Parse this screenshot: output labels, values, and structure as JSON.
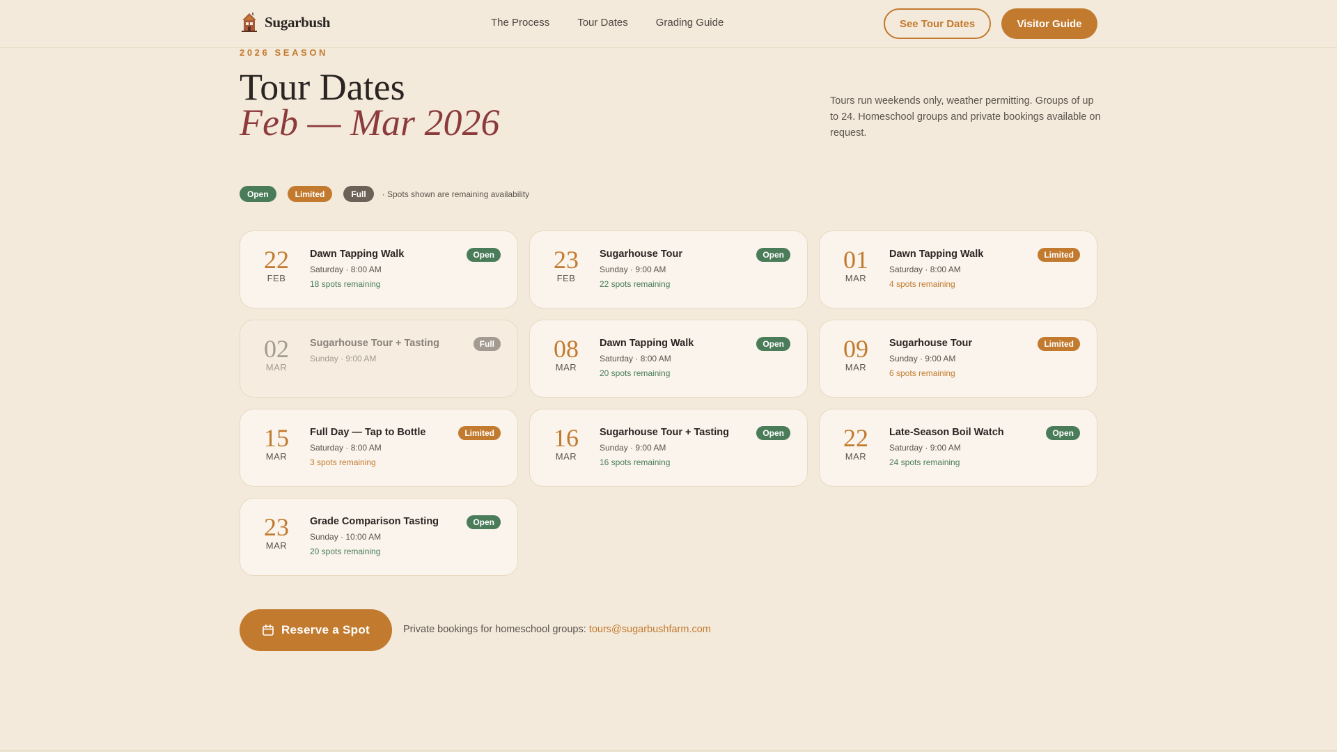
{
  "brand": {
    "name": "Sugarbush",
    "logo_icon": "maple-sugarhouse-icon"
  },
  "nav": {
    "items": [
      "The Process",
      "Tour Dates",
      "Grading Guide"
    ]
  },
  "header_buttons": {
    "outline": "See Tour Dates",
    "solid": "Visitor Guide"
  },
  "hero": {
    "eyebrow": "2026 SEASON",
    "title": "Tour Dates",
    "subtitle": "Feb — Mar 2026",
    "intro": "Tours run weekends only, weather permitting. Groups of up to 24. Homeschool groups and private bookings available on request."
  },
  "legend": {
    "open": "Open",
    "limited": "Limited",
    "full": "Full",
    "note": "· Spots shown are remaining availability"
  },
  "colors": {
    "accent": "#c27a2e",
    "open": "#4a7c59",
    "full": "#6e6258",
    "subtitle": "#8c3b3b",
    "background": "#f4eadb"
  },
  "tours": [
    {
      "day": "22",
      "month": "FEB",
      "name": "Dawn Tapping Walk",
      "time": "Saturday · 8:00 AM",
      "status": "Open",
      "status_key": "open",
      "spots": "18 spots remaining"
    },
    {
      "day": "23",
      "month": "FEB",
      "name": "Sugarhouse Tour",
      "time": "Sunday · 9:00 AM",
      "status": "Open",
      "status_key": "open",
      "spots": "22 spots remaining"
    },
    {
      "day": "01",
      "month": "MAR",
      "name": "Dawn Tapping Walk",
      "time": "Saturday · 8:00 AM",
      "status": "Limited",
      "status_key": "limited",
      "spots": "4 spots remaining"
    },
    {
      "day": "02",
      "month": "MAR",
      "name": "Sugarhouse Tour + Tasting",
      "time": "Sunday · 9:00 AM",
      "status": "Full",
      "status_key": "full",
      "spots": ""
    },
    {
      "day": "08",
      "month": "MAR",
      "name": "Dawn Tapping Walk",
      "time": "Saturday · 8:00 AM",
      "status": "Open",
      "status_key": "open",
      "spots": "20 spots remaining"
    },
    {
      "day": "09",
      "month": "MAR",
      "name": "Sugarhouse Tour",
      "time": "Sunday · 9:00 AM",
      "status": "Limited",
      "status_key": "limited",
      "spots": "6 spots remaining"
    },
    {
      "day": "15",
      "month": "MAR",
      "name": "Full Day — Tap to Bottle",
      "time": "Saturday · 8:00 AM",
      "status": "Limited",
      "status_key": "limited",
      "spots": "3 spots remaining"
    },
    {
      "day": "16",
      "month": "MAR",
      "name": "Sugarhouse Tour + Tasting",
      "time": "Sunday · 9:00 AM",
      "status": "Open",
      "status_key": "open",
      "spots": "16 spots remaining"
    },
    {
      "day": "22",
      "month": "MAR",
      "name": "Late-Season Boil Watch",
      "time": "Saturday · 9:00 AM",
      "status": "Open",
      "status_key": "open",
      "spots": "24 spots remaining"
    },
    {
      "day": "23",
      "month": "MAR",
      "name": "Grade Comparison Tasting",
      "time": "Sunday · 10:00 AM",
      "status": "Open",
      "status_key": "open",
      "spots": "20 spots remaining"
    }
  ],
  "cta": {
    "reserve_label": "Reserve a Spot",
    "reserve_icon": "calendar-icon",
    "private_text": "Private bookings for homeschool groups: ",
    "email": "tours@sugarbushfarm.com"
  }
}
